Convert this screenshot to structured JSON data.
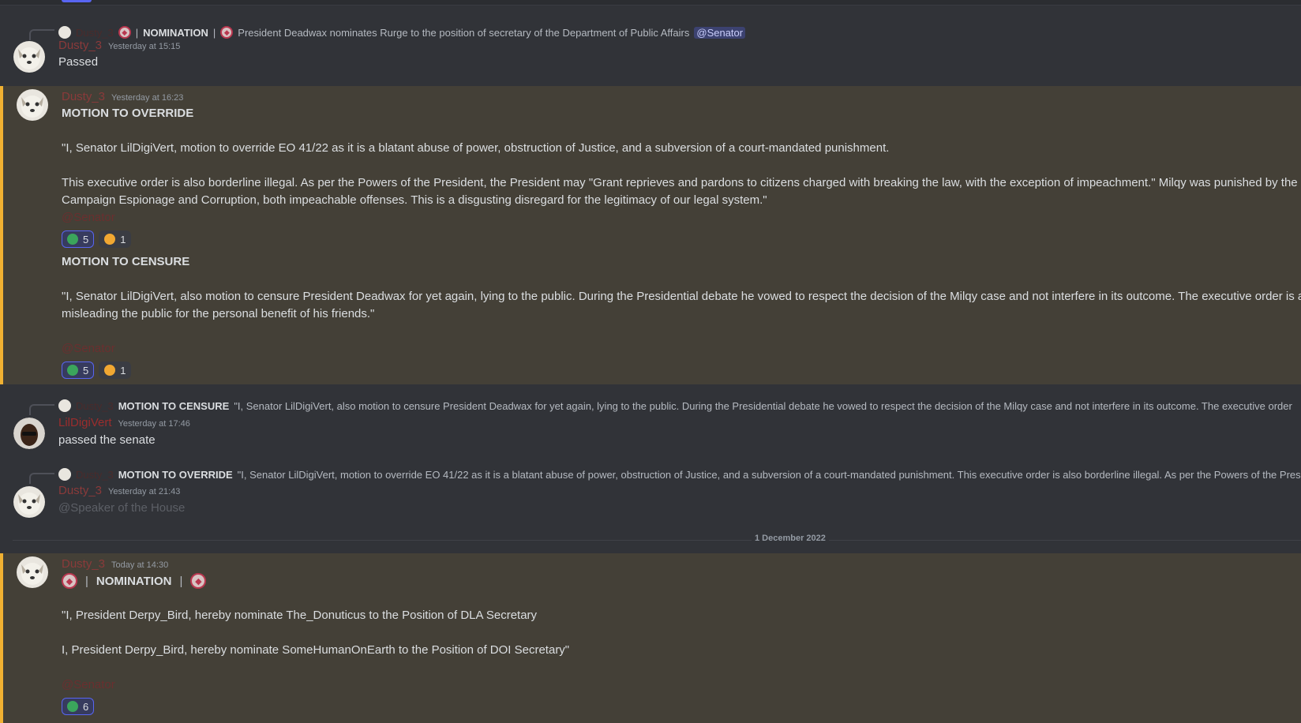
{
  "messages": [
    {
      "reply": {
        "author": "Dusty_3",
        "bold": "NOMINATION",
        "text": "President Deadwax nominates Rurge to the position of secretary of the Department of Public Affairs",
        "mention": "@Senator"
      },
      "author": "Dusty_3",
      "timestamp": "Yesterday at 15:15",
      "text": "Passed"
    },
    {
      "author": "Dusty_3",
      "timestamp": "Yesterday at 16:23",
      "title1": "MOTION TO OVERRIDE",
      "p1": "\"I, Senator LilDigiVert, motion to override EO 41/22 as it is a blatant abuse of power, obstruction of Justice, and a subversion of a court-mandated punishment.",
      "p2a": "This executive order is also borderline illegal. As per the Powers of the President, the President may \"Grant reprieves and pardons to citizens charged with breaking the law, with the exception of impeachment.\" Milqy was punished by the co",
      "p2b": "Campaign Espionage and Corruption, both impeachable offenses. This is a disgusting disregard for the legitimacy of our legal system.\"",
      "ping1": "@Senator",
      "reactions1": [
        {
          "count": "5",
          "icon": "green-face",
          "me": true
        },
        {
          "count": "1",
          "icon": "orange-face",
          "me": false
        }
      ],
      "title2": "MOTION TO CENSURE",
      "p3a": "\"I, Senator LilDigiVert, also motion to censure President Deadwax for yet again, lying to the public. During the Presidential debate he vowed to respect the decision of the Milqy case and not interfere in its outcome. The executive order is and",
      "p3b": "misleading the public for the personal benefit of his friends.\"",
      "ping2": "@Senator",
      "reactions2": [
        {
          "count": "5",
          "icon": "green-face",
          "me": true
        },
        {
          "count": "1",
          "icon": "orange-face",
          "me": false
        }
      ]
    },
    {
      "reply": {
        "author": "Dusty_3",
        "bold": "MOTION TO CENSURE",
        "text": "\"I, Senator LilDigiVert, also motion to censure President Deadwax for yet again, lying to the public. During the Presidential debate he vowed to respect the decision of the Milqy case and not interfere in its outcome. The executive order"
      },
      "author": "LilDigiVert",
      "timestamp": "Yesterday at 17:46",
      "text": "passed the senate"
    },
    {
      "reply": {
        "author": "Dusty_3",
        "bold": "MOTION TO OVERRIDE",
        "text": "\"I, Senator LilDigiVert, motion to override EO 41/22 as it is a blatant abuse of power, obstruction of Justice, and a subversion of a court-mandated punishment.   This executive order is also borderline illegal. As per the Powers of the Pres"
      },
      "author": "Dusty_3",
      "timestamp": "Yesterday at 21:43",
      "text": "@Speaker of the House"
    },
    {
      "author": "Dusty_3",
      "timestamp": "Today at 14:30",
      "title": "NOMINATION",
      "p1": "\"I, President Derpy_Bird, hereby nominate The_Donuticus to the Position of DLA Secretary",
      "p2": "I, President Derpy_Bird, hereby nominate SomeHumanOnEarth to the Position of DOI Secretary\"",
      "ping": "@Senator",
      "reactions": [
        {
          "count": "6",
          "icon": "green-face",
          "me": true
        }
      ]
    }
  ],
  "date_divider": "1 December 2022",
  "colors": {
    "background": "#313338",
    "mention_bg": "#444037",
    "mention_bar": "#f0b132",
    "username": "#8a3a3a",
    "accent": "#5865f2"
  }
}
